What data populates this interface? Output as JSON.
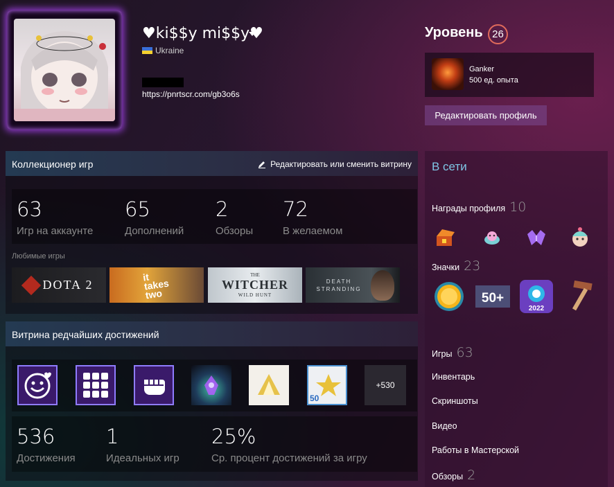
{
  "profile": {
    "name": "♥ki$$y mi$$y♥",
    "country": "Ukraine",
    "link": "https://pnrtscr.com/gb3o6s"
  },
  "level": {
    "label": "Уровень",
    "value": "26",
    "xp_name": "Ganker",
    "xp_value": "500 ед. опыта",
    "edit_profile": "Редактировать профиль"
  },
  "collector": {
    "title": "Коллекционер игр",
    "edit": "Редактировать или сменить витрину",
    "stats": [
      {
        "num": "63",
        "label": "Игр на аккаунте"
      },
      {
        "num": "65",
        "label": "Дополнений"
      },
      {
        "num": "2",
        "label": "Обзоры"
      },
      {
        "num": "72",
        "label": "В желаемом"
      }
    ],
    "fav_label": "Любимые игры",
    "games": {
      "dota": "DOTA 2",
      "itt_1": "it",
      "itt_2": "takes",
      "itt_3": "two",
      "witcher_1": "THE",
      "witcher_2": "WITCHER",
      "witcher_3": "WILD HUNT",
      "ds_1": "DEATH",
      "ds_2": "STRANDING"
    }
  },
  "achievements": {
    "title": "Витрина редчайших достижений",
    "more": "+530",
    "badge50": "50",
    "stats": [
      {
        "num": "536",
        "label": "Достижения"
      },
      {
        "num": "1",
        "label": "Идеальных игр"
      },
      {
        "num": "25%",
        "label": "Ср. процент достижений за игру"
      }
    ]
  },
  "sidebar": {
    "online": "В сети",
    "awards_label": "Награды профиля",
    "awards_count": "10",
    "badges_label": "Значки",
    "badges_count": "23",
    "badge_50": "50+",
    "badge_2022": "2022",
    "games_label": "Игры",
    "games_count": "63",
    "inventory": "Инвентарь",
    "screenshots": "Скриншоты",
    "video": "Видео",
    "workshop": "Работы в Мастерской",
    "reviews_label": "Обзоры",
    "reviews_count": "2"
  },
  "colors": {
    "accent_online": "#7fc7e6",
    "level_ring": "#e06a5b",
    "achievement_border": "#8f7cff"
  }
}
